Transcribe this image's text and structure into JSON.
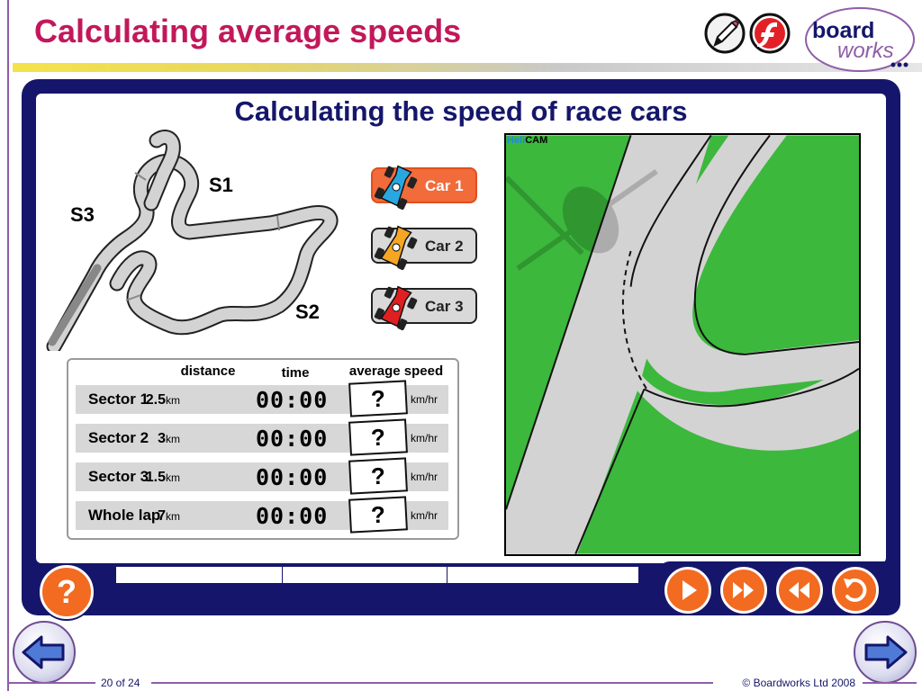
{
  "slide": {
    "title": "Calculating average speeds",
    "page": "20 of 24",
    "copyright": "© Boardworks Ltd 2008",
    "logo_text_1": "board",
    "logo_text_2": "works"
  },
  "colors": {
    "title": "#c2185b",
    "navy": "#15166b",
    "orange": "#f26b21",
    "grass": "#3cb83c",
    "track": "#d3d3d3"
  },
  "sim": {
    "title": "Calculating the speed of race cars",
    "sectors": {
      "s1": "S1",
      "s2": "S2",
      "s3": "S3"
    },
    "cars": [
      {
        "label": "Car 1",
        "color": "#29a8e0",
        "active": true
      },
      {
        "label": "Car 2",
        "color": "#f5a623",
        "active": false
      },
      {
        "label": "Car 3",
        "color": "#e02020",
        "active": false
      }
    ],
    "table": {
      "headers": {
        "distance": "distance",
        "time": "time",
        "speed": "average speed"
      },
      "rows": [
        {
          "name": "Sector 1",
          "distance": "2.5",
          "dist_unit": "km",
          "time": "00:00",
          "speed": "?",
          "speed_unit": "km/hr"
        },
        {
          "name": "Sector 2",
          "distance": "3",
          "dist_unit": "km",
          "time": "00:00",
          "speed": "?",
          "speed_unit": "km/hr"
        },
        {
          "name": "Sector 3",
          "distance": "1.5",
          "dist_unit": "km",
          "time": "00:00",
          "speed": "?",
          "speed_unit": "km/hr"
        },
        {
          "name": "Whole lap",
          "distance": "7",
          "dist_unit": "km",
          "time": "00:00",
          "speed": "?",
          "speed_unit": "km/hr"
        }
      ]
    },
    "helicam": {
      "prefix": "Heli",
      "suffix": "CAM"
    },
    "help_label": "?"
  },
  "icons": {
    "pencil": "pencil-icon",
    "flash": "flash-icon",
    "play": "play-icon",
    "fast_forward": "fast-forward-icon",
    "rewind": "rewind-icon",
    "reset": "reset-icon",
    "prev": "previous-slide-icon",
    "next": "next-slide-icon"
  }
}
